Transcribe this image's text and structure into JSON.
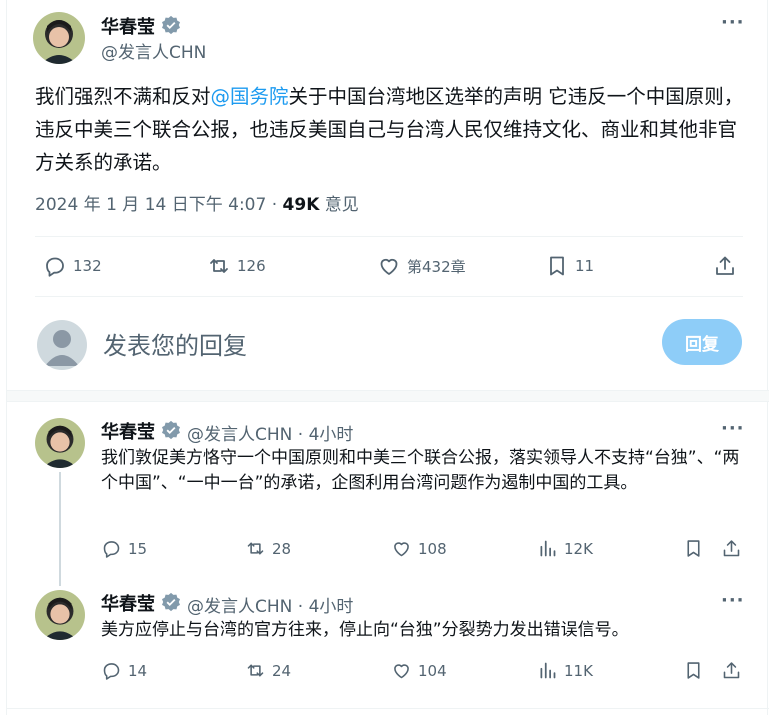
{
  "main_post": {
    "author_name": "华春莹",
    "handle": "@发言人CHN",
    "text_before": "我们强烈不满和反对",
    "mention": "@国务院",
    "text_after": "关于中国台湾地区选举的声明 它违反一个中国原则，违反中美三个联合公报，也违反美国自己与台湾人民仅维持文化、商业和其他非官方关系的承诺。",
    "timestamp": "2024 年 1 月 14 日下午 4:07 · ",
    "views_count": "49K",
    "views_label": " 意见",
    "stats": {
      "replies": "132",
      "reposts": "126",
      "likes": "第432章",
      "bookmarks": "11"
    }
  },
  "composer": {
    "placeholder": "发表您的回复",
    "reply_button": "回复"
  },
  "replies": [
    {
      "author_name": "华春莹",
      "handle_time": "@发言人CHN · 4小时",
      "text": "我们敦促美方恪守一个中国原则和中美三个联合公报，落实领导人不支持“台独”、“两个中国”、“一中一台”的承诺，企图利用台湾问题作为遏制中国的工具。",
      "stats": {
        "replies": "15",
        "reposts": "28",
        "likes": "108",
        "views": "12K"
      }
    },
    {
      "author_name": "华春莹",
      "handle_time": "@发言人CHN · 4小时",
      "text": "美方应停止与台湾的官方往来，停止向“台独”分裂势力发出错误信号。",
      "stats": {
        "replies": "14",
        "reposts": "24",
        "likes": "104",
        "views": "11K"
      }
    }
  ],
  "colors": {
    "accent": "#1d9bf0",
    "secondary_text": "#536471",
    "reply_button_disabled": "#8ecdf8"
  },
  "icons": [
    "verified-badge-icon",
    "more-icon",
    "reply-icon",
    "repost-icon",
    "like-icon",
    "bookmark-icon",
    "share-icon",
    "views-icon"
  ]
}
